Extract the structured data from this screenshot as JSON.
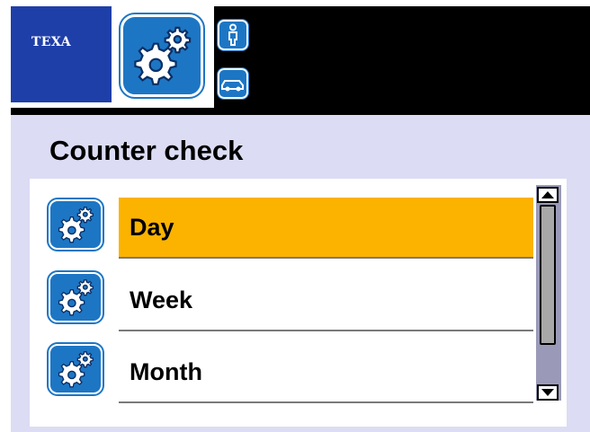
{
  "header": {
    "logo_text": "TEXA",
    "main_icon": "gears-icon",
    "side_icons": [
      "person-icon",
      "car-icon"
    ]
  },
  "page": {
    "title": "Counter check"
  },
  "menu": {
    "items": [
      {
        "label": "Day",
        "icon": "gears-icon",
        "selected": true
      },
      {
        "label": "Week",
        "icon": "gears-icon",
        "selected": false
      },
      {
        "label": "Month",
        "icon": "gears-icon",
        "selected": false
      }
    ]
  },
  "scrollbar": {
    "position": 0
  },
  "colors": {
    "brand_blue": "#1f3fa8",
    "icon_blue": "#1d76c4",
    "selection": "#fbb300",
    "panel": "#dcdcf4"
  }
}
